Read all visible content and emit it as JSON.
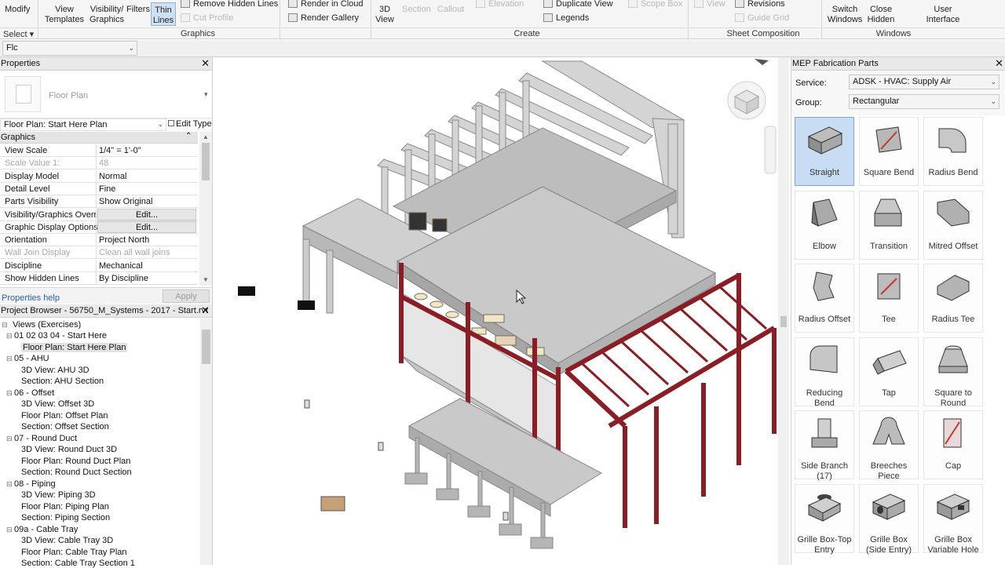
{
  "ribbon": {
    "modify": "Modify",
    "view_templates": [
      "View",
      "Templates"
    ],
    "visibility_graphics": [
      "Visibility/",
      "Graphics"
    ],
    "filters": "Filters",
    "thin_lines": [
      "Thin",
      "Lines"
    ],
    "remove_hidden_lines": "Remove  Hidden Lines",
    "cut_profile": "Cut  Profile",
    "render_in_cloud": "Render  in Cloud",
    "render_gallery": "Render  Gallery",
    "view_3d": [
      "3D",
      "View"
    ],
    "section": "Section",
    "callout": "Callout",
    "elevation": "Elevation",
    "duplicate_view": "Duplicate  View",
    "legends": "Legends",
    "scope_box": "Scope  Box",
    "view": "View",
    "revisions": "Revisions",
    "guide_grid": "Guide  Grid",
    "switch_windows": [
      "Switch",
      "Windows"
    ],
    "close_hidden": [
      "Close",
      "Hidden"
    ],
    "user_interface": [
      "User",
      "Interface"
    ],
    "panels": {
      "select": "Select",
      "graphics": "Graphics",
      "create": "Create",
      "sheet_composition": "Sheet Composition",
      "windows": "Windows"
    }
  },
  "options_bar": {
    "value": "Flc"
  },
  "properties": {
    "title": "Properties",
    "type_name": "Floor Plan",
    "instance": "Floor Plan: Start Here Plan",
    "edit_type": "Edit Type",
    "section": "Graphics",
    "rows": [
      {
        "k": "View Scale",
        "v": "1/4\" = 1'-0\""
      },
      {
        "k": "Scale Value    1:",
        "v": "48"
      },
      {
        "k": "Display Model",
        "v": "Normal"
      },
      {
        "k": "Detail Level",
        "v": "Fine"
      },
      {
        "k": "Parts Visibility",
        "v": "Show Original"
      },
      {
        "k": "Visibility/Graphics Overri...",
        "v": "Edit..."
      },
      {
        "k": "Graphic Display Options",
        "v": "Edit..."
      },
      {
        "k": "Orientation",
        "v": "Project North"
      },
      {
        "k": "Wall Join Display",
        "v": "Clean all wall joins"
      },
      {
        "k": "Discipline",
        "v": "Mechanical"
      },
      {
        "k": "Show Hidden Lines",
        "v": "By Discipline"
      }
    ],
    "help": "Properties help",
    "apply": "Apply"
  },
  "browser": {
    "title": "Project Browser - 56750_M_Systems - 2017 - Start.rvt",
    "root": "Views (Exercises)",
    "items": [
      {
        "t": "01 02 03 04 - Start Here",
        "lvl": 1
      },
      {
        "t": "Floor Plan: Start Here Plan",
        "lvl": 2
      },
      {
        "t": "05 - AHU",
        "lvl": 1
      },
      {
        "t": "3D View: AHU 3D",
        "lvl": 2
      },
      {
        "t": "Section: AHU Section",
        "lvl": 2
      },
      {
        "t": "06 - Offset",
        "lvl": 1
      },
      {
        "t": "3D View: Offset 3D",
        "lvl": 2
      },
      {
        "t": "Floor Plan: Offset Plan",
        "lvl": 2
      },
      {
        "t": "Section: Offset Section",
        "lvl": 2
      },
      {
        "t": "07 - Round Duct",
        "lvl": 1
      },
      {
        "t": "3D View: Round Duct 3D",
        "lvl": 2
      },
      {
        "t": "Floor Plan: Round Duct Plan",
        "lvl": 2
      },
      {
        "t": "Section: Round Duct Section",
        "lvl": 2
      },
      {
        "t": "08 - Piping",
        "lvl": 1
      },
      {
        "t": "3D View: Piping 3D",
        "lvl": 2
      },
      {
        "t": "Floor Plan: Piping Plan",
        "lvl": 2
      },
      {
        "t": "Section: Piping Section",
        "lvl": 2
      },
      {
        "t": "09a - Cable Tray",
        "lvl": 1
      },
      {
        "t": "3D View: Cable Tray 3D",
        "lvl": 2
      },
      {
        "t": "Floor Plan: Cable Tray Plan",
        "lvl": 2
      },
      {
        "t": "Section: Cable Tray Section 1",
        "lvl": 2
      }
    ]
  },
  "mep": {
    "title": "MEP Fabrication Parts",
    "service_label": "Service:",
    "service_value": "ADSK - HVAC: Supply Air",
    "group_label": "Group:",
    "group_value": "Rectangular",
    "parts": [
      "Straight",
      "Square Bend",
      "Radius Bend",
      "Elbow",
      "Transition",
      "Mitred Offset",
      "Radius Offset",
      "Tee",
      "Radius Tee",
      "Reducing Bend",
      "Tap",
      "Square to Round",
      "Side Branch (17)",
      "Breeches Piece",
      "Cap",
      "Grille Box-Top Entry",
      "Grille Box (Side Entry)",
      "Grille Box Variable Hole"
    ]
  },
  "colors": {
    "steel": "#8b1e24",
    "selection": "#c8ddf3",
    "model": "#c9c9c9"
  }
}
